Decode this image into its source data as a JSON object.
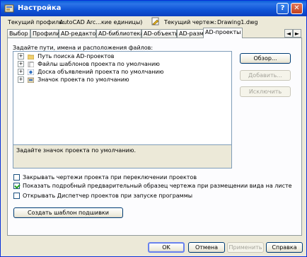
{
  "window": {
    "title": "Настройка",
    "help": "?",
    "close": "✕"
  },
  "info": {
    "profile_label": "Текущий профиль:",
    "profile_value": "AutoCAD Arc...кие единицы)",
    "drawing_label": "Текущий чертеж:",
    "drawing_value": "Drawing1.dwg"
  },
  "tabs": [
    {
      "label": "Выбор"
    },
    {
      "label": "Профили"
    },
    {
      "label": "AD-редактор"
    },
    {
      "label": "AD-библиотека"
    },
    {
      "label": "AD-объекты"
    },
    {
      "label": "AD-размеры"
    },
    {
      "label": "AD-проекты"
    }
  ],
  "tab_scroll": {
    "left": "◄",
    "right": "►"
  },
  "panel": {
    "label": "Задайте пути, имена и расположения файлов:",
    "tree": [
      {
        "label": "Путь поиска AD-проектов"
      },
      {
        "label": "Файлы шаблонов проекта по умолчанию"
      },
      {
        "label": "Доска объявлений проекта по умолчанию"
      },
      {
        "label": "Значок проекта по умолчанию"
      }
    ],
    "buttons": {
      "browse": "Обзор...",
      "add": "Добавить...",
      "remove": "Исключить"
    },
    "description": "Задайте значок проекта по умолчанию.",
    "checkboxes": [
      {
        "label": "Закрывать чертежи проекта при переключении проектов",
        "checked": false
      },
      {
        "label": "Показать подробный предварительный образец чертежа при размещении вида на листе",
        "checked": true
      },
      {
        "label": "Открывать Диспетчер проектов при запуске программы",
        "checked": false
      }
    ],
    "create_template": "Создать шаблон подшивки"
  },
  "footer": {
    "ok": "OK",
    "cancel": "Отмена",
    "apply": "Применить",
    "help": "Справка"
  }
}
